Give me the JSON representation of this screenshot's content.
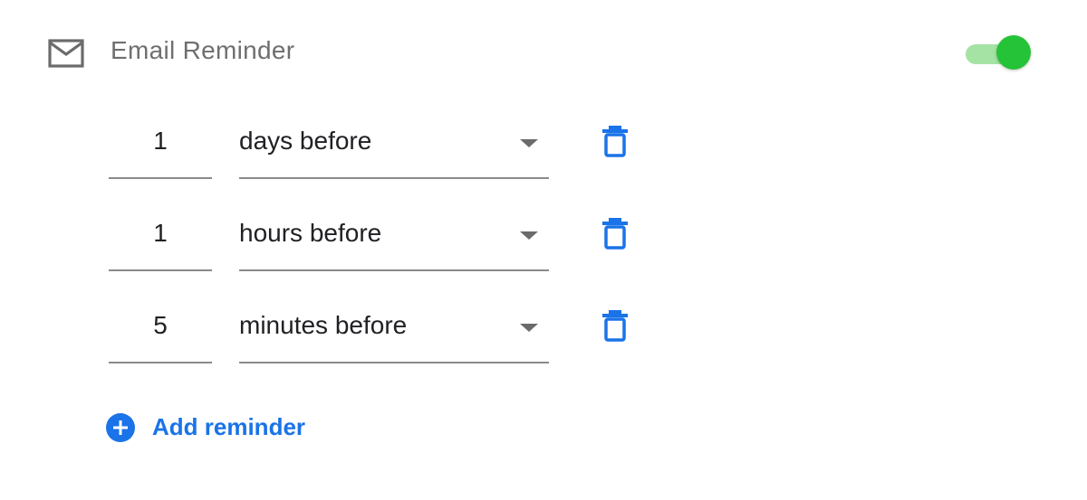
{
  "header": {
    "title": "Email Reminder",
    "icon": "mail-icon",
    "toggle": {
      "enabled": true,
      "track_color": "#a5e3a5",
      "thumb_color": "#25c337"
    }
  },
  "reminders": [
    {
      "amount": "1",
      "unit": "days before"
    },
    {
      "amount": "1",
      "unit": "hours before"
    },
    {
      "amount": "5",
      "unit": "minutes before"
    }
  ],
  "add_reminder": {
    "label": "Add reminder",
    "icon": "plus-circle-icon"
  },
  "colors": {
    "accent": "#1a73e8",
    "text": "#202124",
    "muted": "#6f6f6f"
  }
}
